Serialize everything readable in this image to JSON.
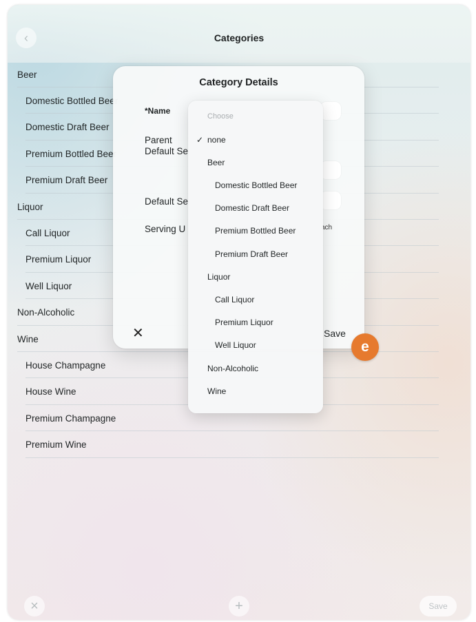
{
  "header": {
    "title": "Categories",
    "back_icon": "chevron-left-icon"
  },
  "categories": [
    {
      "label": "Beer",
      "level": 0
    },
    {
      "label": "Domestic Bottled Beer",
      "level": 1
    },
    {
      "label": "Domestic Draft Beer",
      "level": 1
    },
    {
      "label": "Premium Bottled Beer",
      "level": 1
    },
    {
      "label": "Premium Draft Beer",
      "level": 1
    },
    {
      "label": "Liquor",
      "level": 0
    },
    {
      "label": "Call Liquor",
      "level": 1
    },
    {
      "label": "Premium Liquor",
      "level": 1
    },
    {
      "label": "Well Liquor",
      "level": 1
    },
    {
      "label": "Non-Alcoholic",
      "level": 0
    },
    {
      "label": "Wine",
      "level": 0
    },
    {
      "label": "House Champagne",
      "level": 1
    },
    {
      "label": "House Wine",
      "level": 1
    },
    {
      "label": "Premium Champagne",
      "level": 1
    },
    {
      "label": "Premium Wine",
      "level": 1
    }
  ],
  "toolbar": {
    "close_icon": "close-icon",
    "add_icon": "plus-icon",
    "save_label": "Save"
  },
  "dialog": {
    "title": "Category Details",
    "fields": {
      "name_label": "*Name",
      "parent_label": "Parent",
      "default_serving_label": "Default Se",
      "default_size_label": "Default Se",
      "serving_unit_label": "Serving U",
      "serving_unit_value_fragment": "ach"
    },
    "save_label": "Save"
  },
  "dropdown": {
    "placeholder": "Choose",
    "selected": "none",
    "options": [
      {
        "label": "none",
        "level": 0,
        "checked": true
      },
      {
        "label": "Beer",
        "level": 0
      },
      {
        "label": "Domestic Bottled Beer",
        "level": 1
      },
      {
        "label": "Domestic Draft Beer",
        "level": 1
      },
      {
        "label": "Premium Bottled Beer",
        "level": 1
      },
      {
        "label": "Premium Draft Beer",
        "level": 1
      },
      {
        "label": "Liquor",
        "level": 0
      },
      {
        "label": "Call Liquor",
        "level": 1
      },
      {
        "label": "Premium Liquor",
        "level": 1
      },
      {
        "label": "Well Liquor",
        "level": 1
      },
      {
        "label": "Non-Alcoholic",
        "level": 0
      },
      {
        "label": "Wine",
        "level": 0
      }
    ]
  },
  "badge": {
    "letter": "e",
    "color": "#e67a2e"
  }
}
